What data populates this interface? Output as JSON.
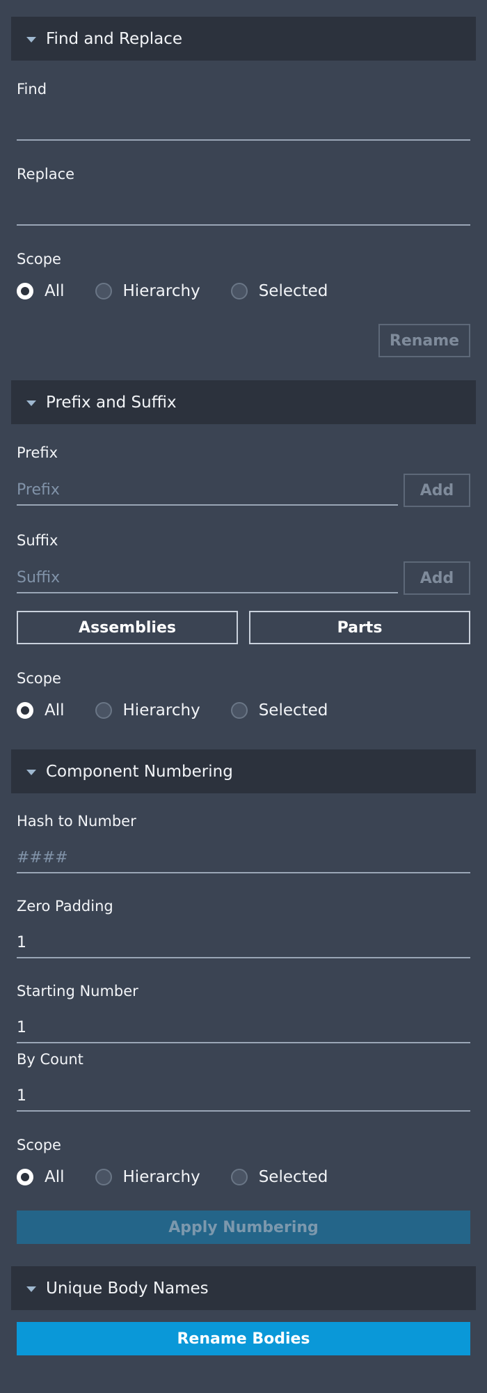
{
  "colors": {
    "background": "#3b4453",
    "header": "#2c323d",
    "primary": "#0a98d8",
    "primary_disabled": "#246589"
  },
  "find_replace": {
    "title": "Find and Replace",
    "find_label": "Find",
    "find_value": "",
    "replace_label": "Replace",
    "replace_value": "",
    "scope_label": "Scope",
    "scope_options": [
      "All",
      "Hierarchy",
      "Selected"
    ],
    "scope_selected": "All",
    "rename_label": "Rename"
  },
  "prefix_suffix": {
    "title": "Prefix and Suffix",
    "prefix_label": "Prefix",
    "prefix_placeholder": "Prefix",
    "prefix_add": "Add",
    "suffix_label": "Suffix",
    "suffix_placeholder": "Suffix",
    "suffix_add": "Add",
    "assemblies_label": "Assemblies",
    "parts_label": "Parts",
    "scope_label": "Scope",
    "scope_options": [
      "All",
      "Hierarchy",
      "Selected"
    ],
    "scope_selected": "All"
  },
  "numbering": {
    "title": "Component Numbering",
    "hash_label": "Hash to Number",
    "hash_placeholder": "####",
    "zero_padding_label": "Zero Padding",
    "zero_padding_value": "1",
    "starting_number_label": "Starting Number",
    "starting_number_value": "1",
    "by_count_label": "By Count",
    "by_count_value": "1",
    "scope_label": "Scope",
    "scope_options": [
      "All",
      "Hierarchy",
      "Selected"
    ],
    "scope_selected": "All",
    "apply_label": "Apply Numbering"
  },
  "unique_bodies": {
    "title": "Unique Body Names",
    "rename_bodies_label": "Rename Bodies"
  }
}
